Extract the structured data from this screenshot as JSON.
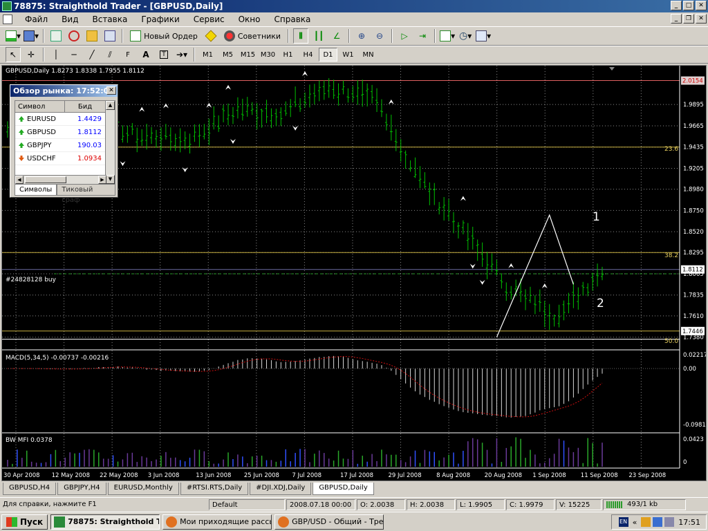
{
  "window": {
    "title": "78875: Straighthold Trader - [GBPUSD,Daily]"
  },
  "menu": [
    "Файл",
    "Вид",
    "Вставка",
    "Графики",
    "Сервис",
    "Окно",
    "Справка"
  ],
  "toolbar1": {
    "new_order": "Новый Ордер",
    "advisors": "Советники"
  },
  "timeframes": [
    "M1",
    "M5",
    "M15",
    "M30",
    "H1",
    "H4",
    "D1",
    "W1",
    "MN"
  ],
  "active_timeframe": "D1",
  "chart": {
    "header": "GBPUSD,Daily  1.8273 1.8338 1.7955 1.8112",
    "order_label": "#24828128 buy",
    "fib_236": "23.6",
    "fib_382": "38.2",
    "fib_500": "50.0",
    "wave_1": "1",
    "wave_2": "2",
    "macd_header": "MACD(5,34,5) -0.00737 -0.00216",
    "mfi_header": "BW MFI 0.0378",
    "price_ticks": [
      "1.9895",
      "1.9665",
      "1.9435",
      "1.9205",
      "1.8980",
      "1.8750",
      "1.8520",
      "1.8295",
      "1.8065",
      "1.7835",
      "1.7610",
      "1.7380"
    ],
    "price_current": "1.8112",
    "price_top": "2.0154",
    "price_low": "1.7446",
    "macd_ticks": [
      "0.02217",
      "0.00",
      "-0.09817"
    ],
    "mfi_ticks": [
      "0.0423",
      "0"
    ],
    "date_ticks": [
      "30 Apr 2008",
      "12 May 2008",
      "22 May 2008",
      "3 Jun 2008",
      "13 Jun 2008",
      "25 Jun 2008",
      "7 Jul 2008",
      "17 Jul 2008",
      "29 Jul 2008",
      "8 Aug 2008",
      "20 Aug 2008",
      "1 Sep 2008",
      "11 Sep 2008",
      "23 Sep 2008"
    ],
    "colors": {
      "up": "#00c000",
      "down": "#00c000",
      "grid": "#8a8a8a",
      "signal": "#d01010"
    }
  },
  "chart_data": {
    "type": "line",
    "title": "GBPUSD,Daily",
    "x": [
      "30 Apr 2008",
      "12 May 2008",
      "22 May 2008",
      "3 Jun 2008",
      "13 Jun 2008",
      "25 Jun 2008",
      "7 Jul 2008",
      "17 Jul 2008",
      "29 Jul 2008",
      "8 Aug 2008",
      "20 Aug 2008",
      "1 Sep 2008",
      "11 Sep 2008",
      "23 Sep 2008"
    ],
    "series": [
      {
        "name": "",
        "values": [
          1.962,
          1.955,
          1.965,
          1.955,
          1.95,
          1.985,
          1.98,
          2.008,
          1.995,
          1.91,
          1.85,
          1.79,
          1.76,
          1.812
        ]
      }
    ],
    "ylim": [
      1.725,
      2.03
    ],
    "xlabel": "",
    "ylabel": ""
  },
  "market_watch": {
    "title": "Обзор рынка: 17:52:04",
    "col_symbol": "Символ",
    "col_bid": "Бид",
    "rows": [
      {
        "symbol": "EURUSD",
        "bid": "1.4429",
        "dir": "up"
      },
      {
        "symbol": "GBPUSD",
        "bid": "1.8112",
        "dir": "up"
      },
      {
        "symbol": "GBPJPY",
        "bid": "190.03",
        "dir": "up"
      },
      {
        "symbol": "USDCHF",
        "bid": "1.0934",
        "dir": "down"
      }
    ],
    "tab_symbols": "Символы",
    "tab_ticks": "Тиковый граф"
  },
  "chart_tabs": [
    {
      "label": "GBPUSD,H4"
    },
    {
      "label": "GBPJPY,H4"
    },
    {
      "label": "EURUSD,Monthly"
    },
    {
      "label": "#RTSI.RTS,Daily"
    },
    {
      "label": "#DJI.XDJ,Daily"
    },
    {
      "label": "GBPUSD,Daily"
    }
  ],
  "active_chart_tab": "GBPUSD,Daily",
  "status": {
    "help": "Для справки, нажмите F1",
    "profile": "Default",
    "datetime": "2008.07.18 00:00",
    "open": "O: 2.0038",
    "high": "H: 2.0038",
    "low": "L: 1.9905",
    "close": "C: 1.9979",
    "volume": "V: 15225",
    "traffic": "493/1 kb"
  },
  "taskbar": {
    "start": "Пуск",
    "tasks": [
      "78875: Straighthold T...",
      "Мои приходящие рассы...",
      "GBP/USD - Общий - Тре..."
    ],
    "lang": "EN",
    "clock": "17:51"
  }
}
